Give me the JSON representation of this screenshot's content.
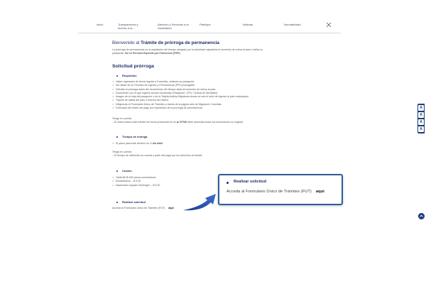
{
  "nav": {
    "items": [
      {
        "label": "Inicio"
      },
      {
        "label": "Transparencia y acceso a la..."
      },
      {
        "label": "Atención y Servicios a la ciudadanía"
      },
      {
        "label": "Participa"
      },
      {
        "label": "Noticias"
      },
      {
        "label": "Normatividad"
      }
    ],
    "close_icon": "close-icon"
  },
  "welcome": {
    "prefix": "Bienvenido al ",
    "title": "Trámite de prórroga de permanencia"
  },
  "intro": {
    "line1": "La prórroga de permanencia es la ampliación del tiempo otorgado por la autoridad migratoria al momento de entrar al país o sellar su",
    "line2_prefix": "pasaporte. ",
    "line2_bold": "No es Permiso Especial por Protección (PEP)."
  },
  "section_title": "Solicitud prórroga",
  "requisitos": {
    "title": "Requisitos",
    "items": [
      "Haber ingresado de forma regular a Colombia, sellando su pasaporte.",
      "Ser titular de un Permiso de Ingreso y Permanencia (PIP) prorrogable.",
      "Solicitar la prórroga antes del vencimiento del tiempo dado al momento de entrar al país.",
      "Documento con el que ingresó al país escaneado (Pasaporte, CPiV, Cédula de Identidad).",
      "Imagen de la hoja del pasaporte o de la Tarjeta Andina Migratoria donde se vea el sello de ingreso al país estampado.",
      "Tiquete de salida del país o reserva del mismo.",
      "Diligenciar el Formulario Único de Trámites a través de la página web de Migración Colombia.",
      "Fotocopia del recibo del pago por expedición de la prórroga de permanencia."
    ],
    "note_title": "Tenga en cuenta:",
    "note_text_prefix": "– El usted realiza este trámite de forma presencial en un",
    "note_bold": "CFSM",
    "note_text_suffix": "debe presentar todos los documentos en original."
  },
  "tiempo": {
    "title": "Tiempo de entrega",
    "item_prefix": "El plazo para este servicio es:",
    "item_bold": "1 día hábil",
    "note_title": "Tenga en cuenta:",
    "note_text": "– El tiempo de obtención se cuenta a partir del pago por los derechos al trámite."
  },
  "costos": {
    "title": "Costos",
    "items": [
      "Tarifa $126.000 pesos colombianos",
      "Ecuatorianos – $ 0,00",
      "Nacionales espacio Schengen – $ 0,00"
    ]
  },
  "realizar": {
    "title": "Realizar solicitud",
    "text": "Acceda al Formulario Único de Trámites (FUT)",
    "link": "aquí"
  },
  "callout": {
    "title": "Realizar solicitud",
    "text": "Acceda al Formulario Único de Trámites (FUT)",
    "link": "aquí",
    "border_color": "#2f5d9c"
  },
  "sidebar": {
    "buttons": [
      "A",
      "A",
      "A",
      "A"
    ]
  },
  "colors": {
    "heading": "#1f2f66",
    "accent": "#1d3d7a"
  }
}
